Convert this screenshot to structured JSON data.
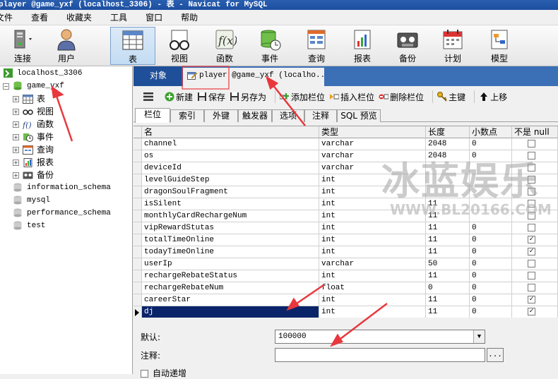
{
  "window": {
    "title": "player @game_yxf (localhost_3306) - 表 - Navicat for MySQL"
  },
  "menu": [
    "文件",
    "查看",
    "收藏夹",
    "工具",
    "窗口",
    "帮助"
  ],
  "toolbar": {
    "connect": "连接",
    "user": "用户",
    "table": "表",
    "view": "视图",
    "function": "函数",
    "event": "事件",
    "query": "查询",
    "report": "报表",
    "backup": "备份",
    "schedule": "计划",
    "model": "模型"
  },
  "tree": {
    "connection": "localhost_3306",
    "database": "game_yxf",
    "children": [
      "表",
      "视图",
      "函数",
      "事件",
      "查询",
      "报表",
      "备份"
    ],
    "other_dbs": [
      "information_schema",
      "mysql",
      "performance_schema",
      "test"
    ]
  },
  "tabs": {
    "objects": "对象",
    "player": "player @game_yxf (localho..."
  },
  "subtoolbar": {
    "new": "新建",
    "save": "保存",
    "save_as": "另存为",
    "add_field": "添加栏位",
    "insert_field": "插入栏位",
    "delete_field": "删除栏位",
    "primary_key": "主键",
    "move_up": "上移"
  },
  "field_tabs": [
    "栏位",
    "索引",
    "外键",
    "触发器",
    "选项",
    "注释",
    "SQL 预览"
  ],
  "columns": {
    "name": "名",
    "type": "类型",
    "length": "长度",
    "decimals": "小数点",
    "not_null": "不是 null"
  },
  "rows": [
    {
      "name": "channel",
      "type": "varchar",
      "length": "2048",
      "decimals": "0",
      "notnull": false
    },
    {
      "name": "os",
      "type": "varchar",
      "length": "2048",
      "decimals": "0",
      "notnull": false
    },
    {
      "name": "deviceId",
      "type": "varchar",
      "length": "",
      "decimals": "",
      "notnull": false
    },
    {
      "name": "levelGuideStep",
      "type": "int",
      "length": "",
      "decimals": "",
      "notnull": false
    },
    {
      "name": "dragonSoulFragment",
      "type": "int",
      "length": "",
      "decimals": "",
      "notnull": false
    },
    {
      "name": "isSilent",
      "type": "int",
      "length": "11",
      "decimals": "",
      "notnull": false
    },
    {
      "name": "monthlyCardRechargeNum",
      "type": "int",
      "length": "11",
      "decimals": "",
      "notnull": false
    },
    {
      "name": "vipRewardStutas",
      "type": "int",
      "length": "11",
      "decimals": "0",
      "notnull": false
    },
    {
      "name": "totalTimeOnline",
      "type": "int",
      "length": "11",
      "decimals": "0",
      "notnull": true
    },
    {
      "name": "todayTimeOnline",
      "type": "int",
      "length": "11",
      "decimals": "0",
      "notnull": true
    },
    {
      "name": "userIp",
      "type": "varchar",
      "length": "50",
      "decimals": "0",
      "notnull": false
    },
    {
      "name": "rechargeRebateStatus",
      "type": "int",
      "length": "11",
      "decimals": "0",
      "notnull": false
    },
    {
      "name": "rechargeRebateNum",
      "type": "float",
      "length": "0",
      "decimals": "0",
      "notnull": false
    },
    {
      "name": "careerStar",
      "type": "int",
      "length": "11",
      "decimals": "0",
      "notnull": true
    },
    {
      "name": "dj",
      "type": "int",
      "length": "11",
      "decimals": "0",
      "notnull": true,
      "selected": true
    }
  ],
  "props": {
    "default_label": "默认:",
    "default_value": "100000",
    "comment_label": "注释:",
    "comment_value": "",
    "browse": "...",
    "auto_increment": "自动递增"
  },
  "watermark": {
    "cn": "冰蓝娱乐",
    "url": "WWW.BL20166.COM"
  },
  "colors": {
    "tab_bar": "#3b6fb6",
    "selected_row": "#0a246a",
    "arrow": "#e8383d"
  }
}
